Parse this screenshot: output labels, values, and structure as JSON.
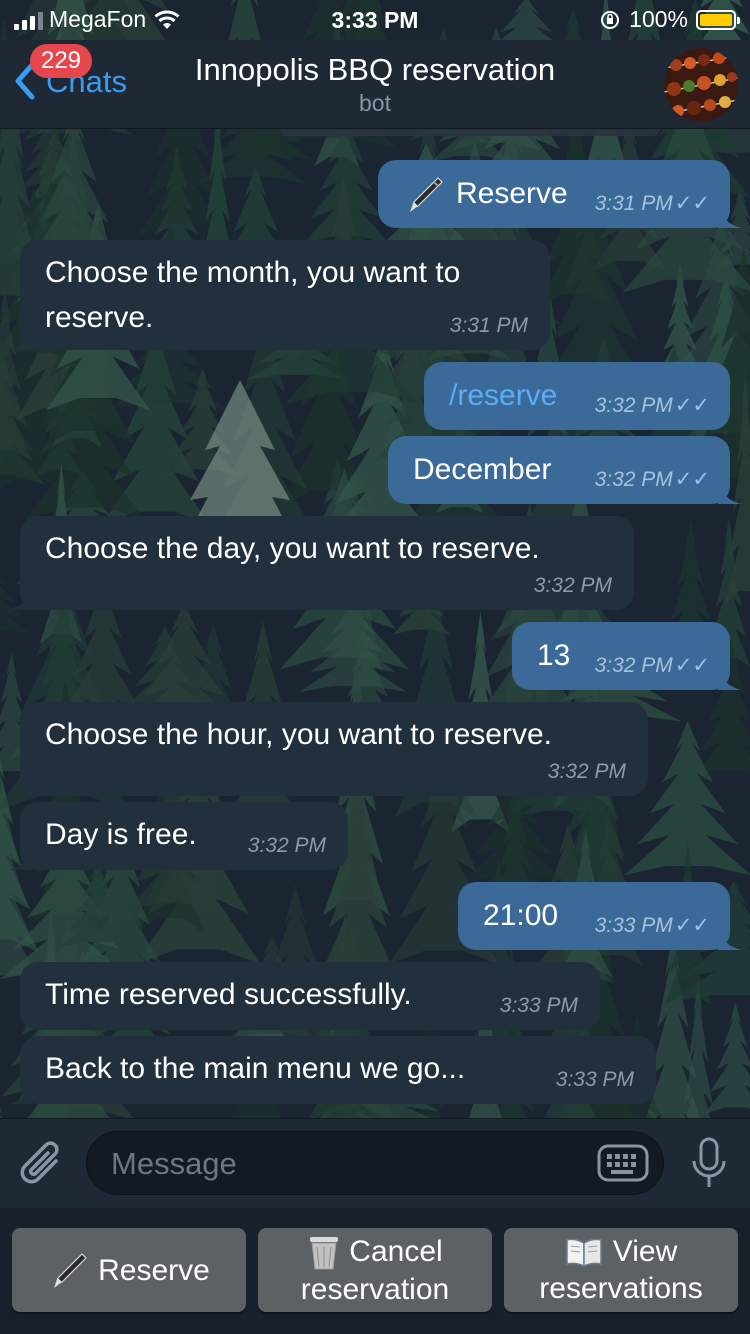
{
  "status_bar": {
    "carrier": "MegaFon",
    "time": "3:33 PM",
    "battery": "100%"
  },
  "header": {
    "back_label": "Chats",
    "unread_badge": "229",
    "title": "Innopolis BBQ reservation",
    "subtitle": "bot"
  },
  "messages": [
    {
      "direction": "out",
      "text": "Reserve",
      "icon": "pen-icon",
      "time": "3:31 PM",
      "read": true
    },
    {
      "direction": "in",
      "line1": "Choose the month, you want to",
      "line2": "reserve.",
      "time": "3:31 PM"
    },
    {
      "direction": "out",
      "text": "/reserve",
      "time": "3:32 PM",
      "read": true
    },
    {
      "direction": "out",
      "text": "December",
      "time": "3:32 PM",
      "read": true
    },
    {
      "direction": "in",
      "text": "Choose the day, you want to reserve.",
      "time": "3:32 PM"
    },
    {
      "direction": "out",
      "text": "13",
      "time": "3:32 PM",
      "read": true
    },
    {
      "direction": "in",
      "text": "Choose the hour, you want to reserve.",
      "time": "3:32 PM"
    },
    {
      "direction": "in",
      "text": "Day is free.",
      "time": "3:32 PM"
    },
    {
      "direction": "out",
      "text": "21:00",
      "time": "3:33 PM",
      "read": true
    },
    {
      "direction": "in",
      "text": "Time reserved successfully.",
      "time": "3:33 PM"
    },
    {
      "direction": "in",
      "text": "Back to the main menu we go...",
      "time": "3:33 PM"
    }
  ],
  "composer": {
    "placeholder": "Message",
    "value": ""
  },
  "reply_keyboard": {
    "reserve": {
      "icon": "pen-icon",
      "label": "Reserve"
    },
    "cancel": {
      "icon": "wastebasket-icon",
      "line1": "Cancel",
      "line2": "reservation"
    },
    "view": {
      "icon": "book-icon",
      "line1": "View",
      "line2": "reservations"
    }
  },
  "colors": {
    "accent": "#3a9cf0",
    "outgoing_bubble": "#3b6a99",
    "incoming_bubble": "#22303e",
    "badge": "#e5474d",
    "battery": "#ffcc00"
  }
}
